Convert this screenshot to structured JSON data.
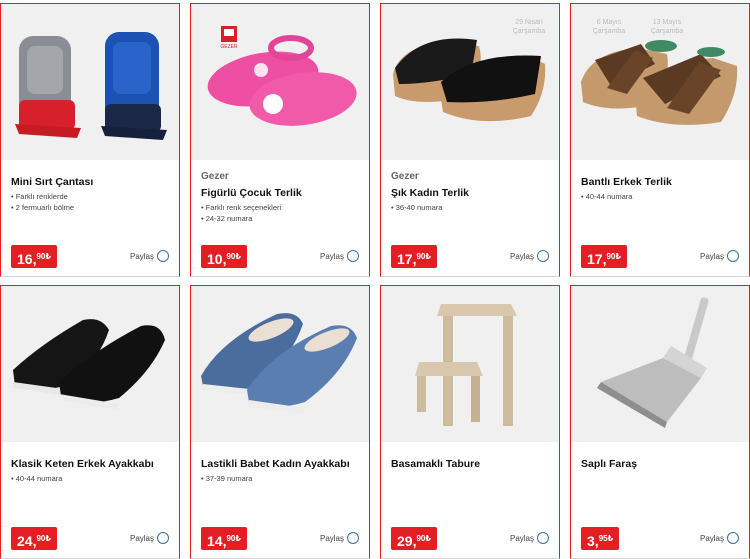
{
  "products": [
    {
      "brand": "",
      "name": "Mini Sırt Çantası",
      "features": [
        "Farklı renklerde",
        "2 fermuarlı bölme"
      ],
      "price_main": "16,",
      "price_dec": "90",
      "currency": "₺",
      "share": "Paylaş",
      "image": "backpack"
    },
    {
      "brand": "Gezer",
      "name": "Figürlü Çocuk Terlik",
      "features": [
        "Farklı renk seçenekleri",
        "24-32 numara"
      ],
      "price_main": "10,",
      "price_dec": "90",
      "currency": "₺",
      "share": "Paylaş",
      "image": "kids-clog",
      "logo": "GEZER"
    },
    {
      "brand": "Gezer",
      "name": "Şık Kadın Terlik",
      "features": [
        "36-40 numara"
      ],
      "price_main": "17,",
      "price_dec": "90",
      "currency": "₺",
      "share": "Paylaş",
      "image": "women-slipper"
    },
    {
      "brand": "",
      "name": "Bantlı Erkek Terlik",
      "features": [
        "40-44 numara"
      ],
      "price_main": "17,",
      "price_dec": "90",
      "currency": "₺",
      "share": "Paylaş",
      "image": "men-slipper"
    },
    {
      "brand": "",
      "name": "Klasik Keten Erkek Ayakkabı",
      "features": [
        "40-44 numara"
      ],
      "price_main": "24,",
      "price_dec": "90",
      "currency": "₺",
      "share": "Paylaş",
      "image": "men-shoe"
    },
    {
      "brand": "",
      "name": "Lastikli Babet Kadın Ayakkabı",
      "features": [
        "37-39 numara"
      ],
      "price_main": "14,",
      "price_dec": "90",
      "currency": "₺",
      "share": "Paylaş",
      "image": "women-shoe"
    },
    {
      "brand": "",
      "name": "Basamaklı Tabure",
      "features": [],
      "price_main": "29,",
      "price_dec": "90",
      "currency": "₺",
      "share": "Paylaş",
      "image": "step-stool"
    },
    {
      "brand": "",
      "name": "Saplı Faraş",
      "features": [],
      "price_main": "3,",
      "price_dec": "95",
      "currency": "₺",
      "share": "Paylaş",
      "image": "dustpan"
    }
  ],
  "overlay_tabs": [
    {
      "line1": "29 Nisan",
      "line2": "Çarşamba"
    },
    {
      "line1": "6 Mayıs",
      "line2": "Çarşamba"
    },
    {
      "line1": "13 Mayıs",
      "line2": "Çarşamba"
    }
  ],
  "colors": {
    "accent": "#e31e24",
    "share_circle": "#3a6ea5",
    "image_bg": "#f0f0f0"
  }
}
